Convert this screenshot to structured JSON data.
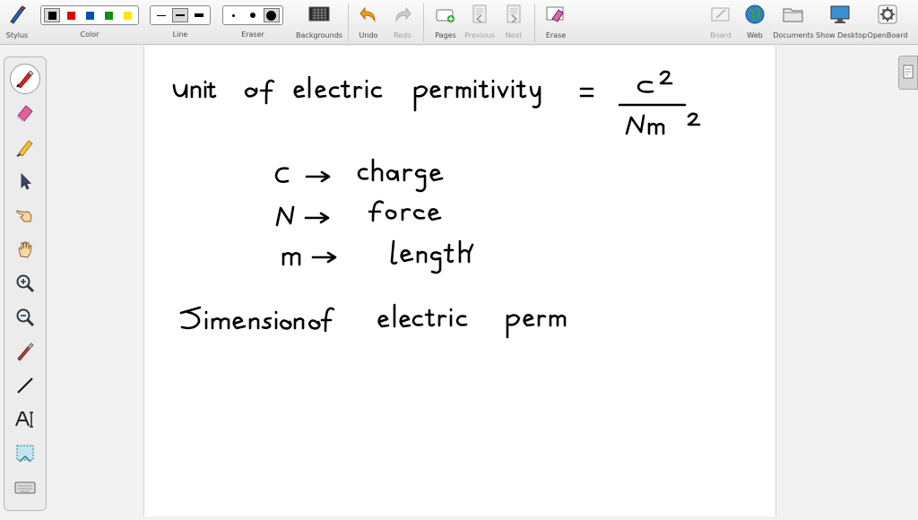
{
  "toolbar": {
    "stylus": "Stylus",
    "color": "Color",
    "line": "Line",
    "eraser": "Eraser",
    "backgrounds": "Backgrounds",
    "undo": "Undo",
    "redo": "Redo",
    "pages": "Pages",
    "previous": "Previous",
    "next": "Next",
    "erase": "Erase",
    "board": "Board",
    "web": "Web",
    "documents": "Documents",
    "show_desktop": "Show Desktop",
    "openboard": "OpenBoard"
  },
  "colors": [
    "#000000",
    "#e00000",
    "#0050b0",
    "#109010",
    "#ffe600"
  ],
  "board_text": {
    "line1": "unit of electric permittivity =",
    "numerator": "C²",
    "denominator": "Nm²",
    "c_line": "C → charge",
    "n_line": "N → force",
    "m_line": "m → length",
    "dimension_line": "Dimension of electric perm"
  }
}
